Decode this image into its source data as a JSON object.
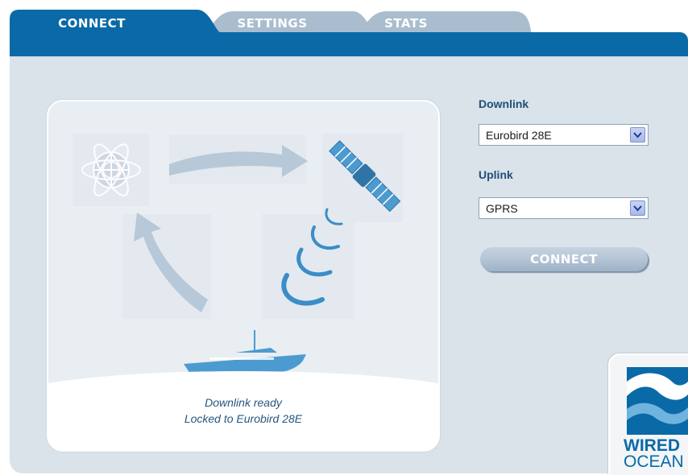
{
  "tabs": [
    {
      "label": "CONNECT",
      "active": true
    },
    {
      "label": "SETTINGS",
      "active": false
    },
    {
      "label": "STATS",
      "active": false
    }
  ],
  "form": {
    "downlink_label": "Downlink",
    "downlink_value": "Eurobird 28E",
    "uplink_label": "Uplink",
    "uplink_value": "GPRS",
    "connect_label": "CONNECT"
  },
  "status": {
    "line1": "Downlink ready",
    "line2": "Locked to Eurobird 28E"
  },
  "logo": {
    "line1": "WIRED",
    "line2": "OCEAN"
  },
  "colors": {
    "brand_blue": "#0a6aa7",
    "panel_bg": "#dae2ea",
    "inactive_tab": "#a9bdcf"
  }
}
